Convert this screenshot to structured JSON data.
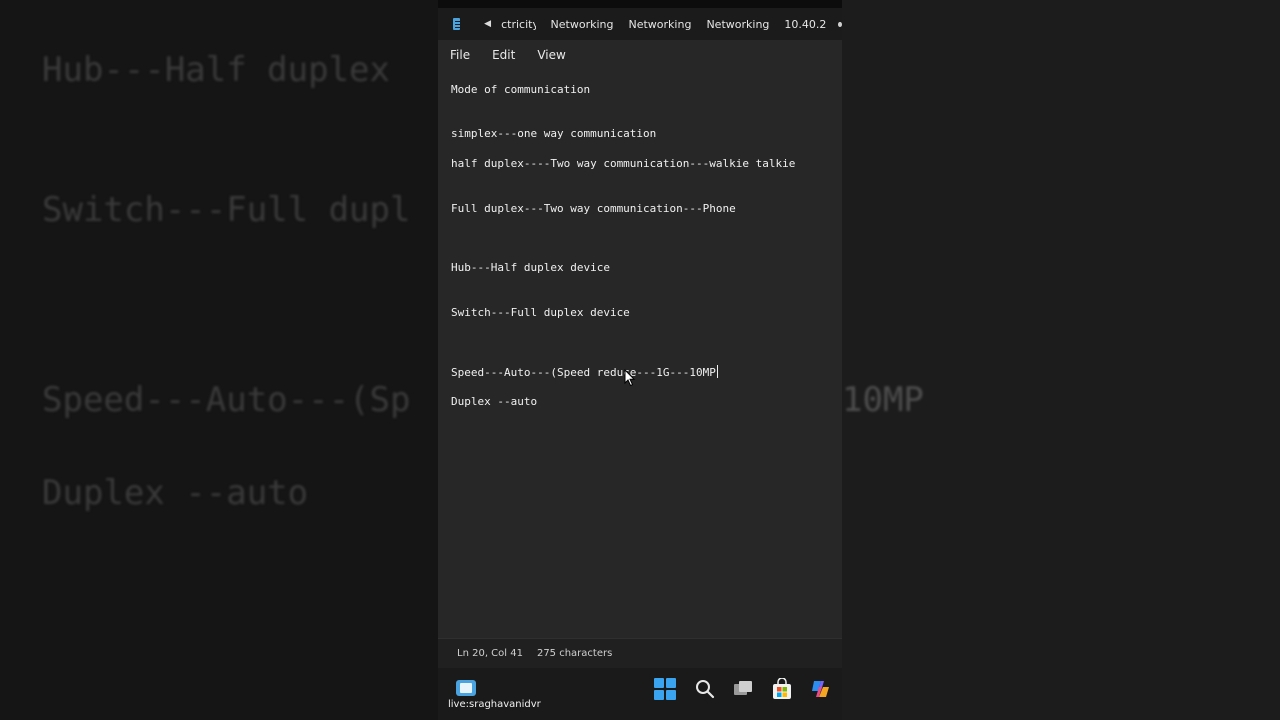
{
  "background": {
    "lines": [
      "Hub---Half duplex",
      "Switch---Full dupl",
      "Speed---Auto---(Sp",
      "Duplex --auto"
    ],
    "right_fragment": "10MP"
  },
  "tabs": {
    "items": [
      "ctricity N",
      "Networking",
      "Networking",
      "Networking",
      "10.40.2"
    ]
  },
  "menu": {
    "file": "File",
    "edit": "Edit",
    "view": "View"
  },
  "editor": {
    "lines": [
      "Mode of communication",
      "simplex---one way communication",
      "half duplex----Two way communication---walkie talkie",
      "Full duplex---Two way communication---Phone",
      "Hub---Half duplex device",
      "Switch---Full duplex device",
      "Speed---Auto---(Speed reduce---1G---10MP",
      "Duplex --auto"
    ]
  },
  "status": {
    "position": "Ln 20, Col 41",
    "characters": "275 characters"
  },
  "taskbar": {
    "live_label": "live:sraghavanidvr"
  },
  "colors": {
    "window_bg": "#272727",
    "accent_blue": "#3ba4f0"
  }
}
